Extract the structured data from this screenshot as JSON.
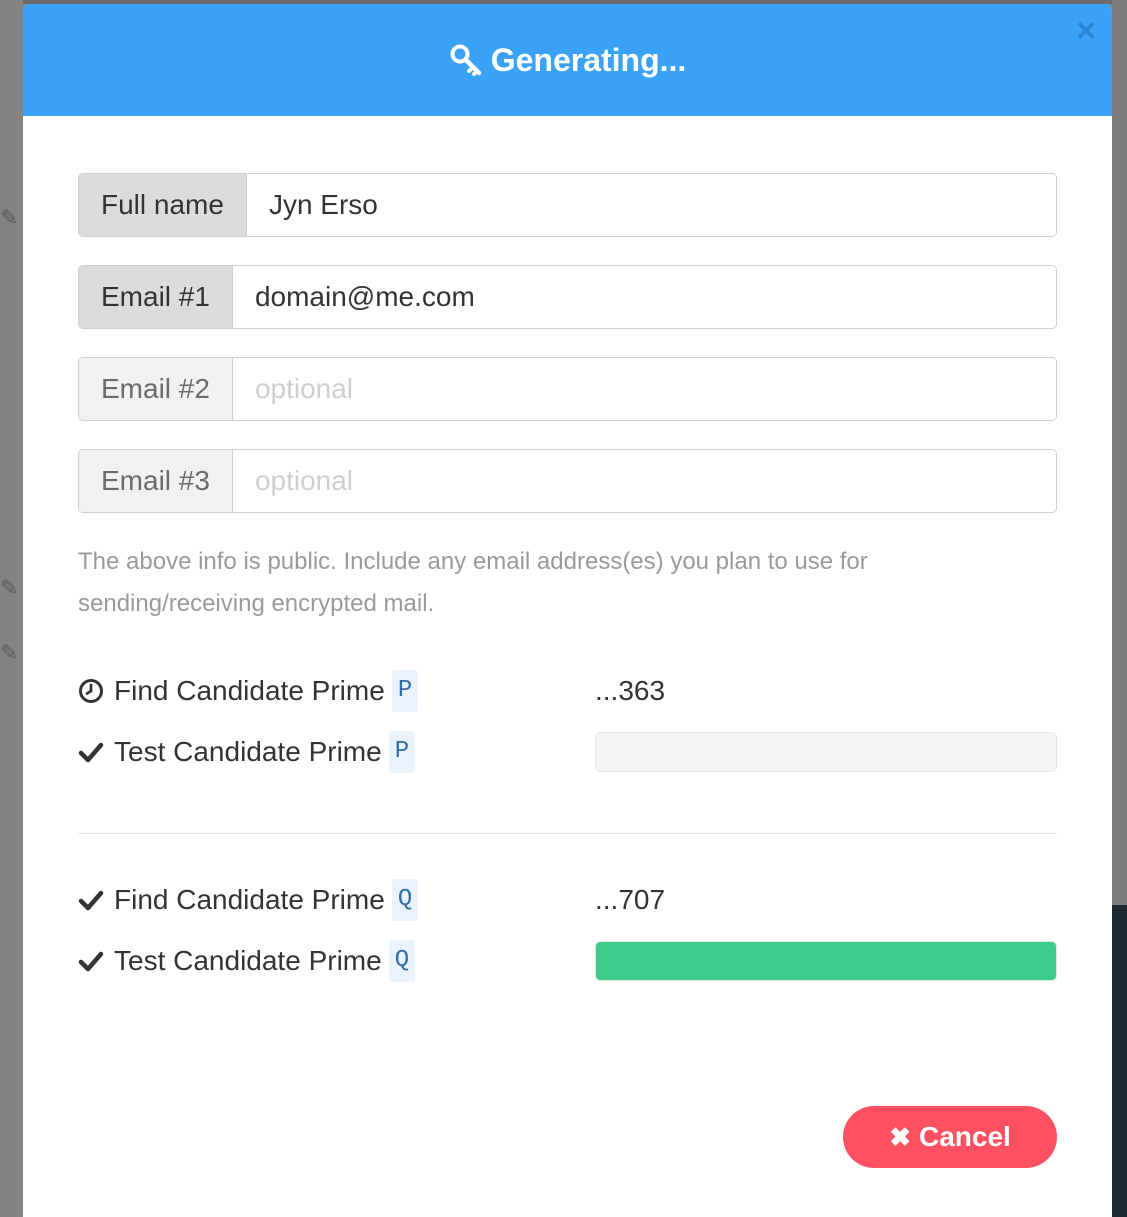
{
  "modal": {
    "title": "Generating...",
    "close_label": "×"
  },
  "form": {
    "fields": [
      {
        "label": "Full name",
        "value": "Jyn Erso",
        "placeholder": ""
      },
      {
        "label": "Email #1",
        "value": "domain@me.com",
        "placeholder": ""
      },
      {
        "label": "Email #2",
        "value": "",
        "placeholder": "optional"
      },
      {
        "label": "Email #3",
        "value": "",
        "placeholder": "optional"
      }
    ],
    "help_text": "The above info is public. Include any email address(es) you plan to use for sending/receiving encrypted mail."
  },
  "steps": {
    "p": {
      "find_label": "Find Candidate Prime",
      "find_badge": "P",
      "find_value": "...363",
      "find_status": "clock-icon",
      "test_label": "Test Candidate Prime",
      "test_badge": "P",
      "test_status": "check-icon",
      "test_progress": 0
    },
    "q": {
      "find_label": "Find Candidate Prime",
      "find_badge": "Q",
      "find_value": "...707",
      "find_status": "check-icon",
      "test_label": "Test Candidate Prime",
      "test_badge": "Q",
      "test_status": "check-icon",
      "test_progress": 100
    }
  },
  "actions": {
    "cancel_label": "Cancel",
    "cancel_icon": "times-icon"
  },
  "colors": {
    "header": "#3aa2f9",
    "cancel": "#ff5062",
    "progress_fill": "#3dcb8b"
  }
}
